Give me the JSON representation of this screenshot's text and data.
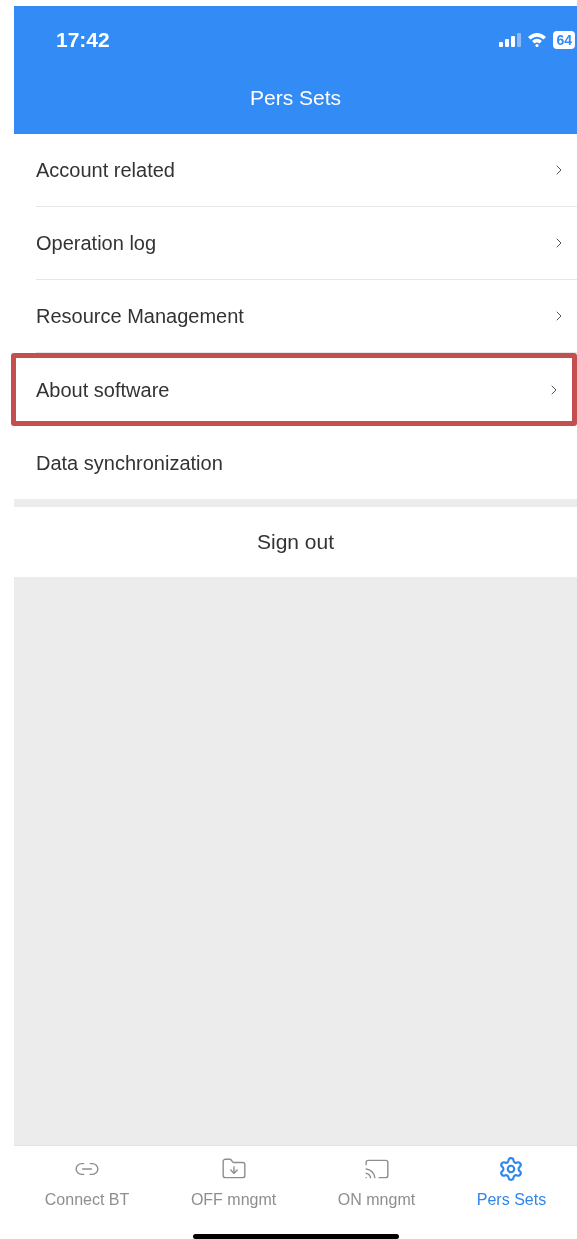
{
  "status_bar": {
    "time": "17:42",
    "battery": "64"
  },
  "header": {
    "title": "Pers Sets"
  },
  "menu_items": [
    {
      "label": "Account related",
      "chevron": true,
      "highlighted": false
    },
    {
      "label": "Operation log",
      "chevron": true,
      "highlighted": false
    },
    {
      "label": "Resource Management",
      "chevron": true,
      "highlighted": false
    },
    {
      "label": "About software",
      "chevron": true,
      "highlighted": true
    },
    {
      "label": "Data synchronization",
      "chevron": false,
      "highlighted": false
    }
  ],
  "sign_out": {
    "label": "Sign out"
  },
  "tab_bar": [
    {
      "label": "Connect BT",
      "kind": "link",
      "selected": false
    },
    {
      "label": "OFF mngmt",
      "kind": "folder",
      "selected": false
    },
    {
      "label": "ON mngmt",
      "kind": "cast",
      "selected": false
    },
    {
      "label": "Pers Sets",
      "kind": "gear",
      "selected": true
    }
  ]
}
